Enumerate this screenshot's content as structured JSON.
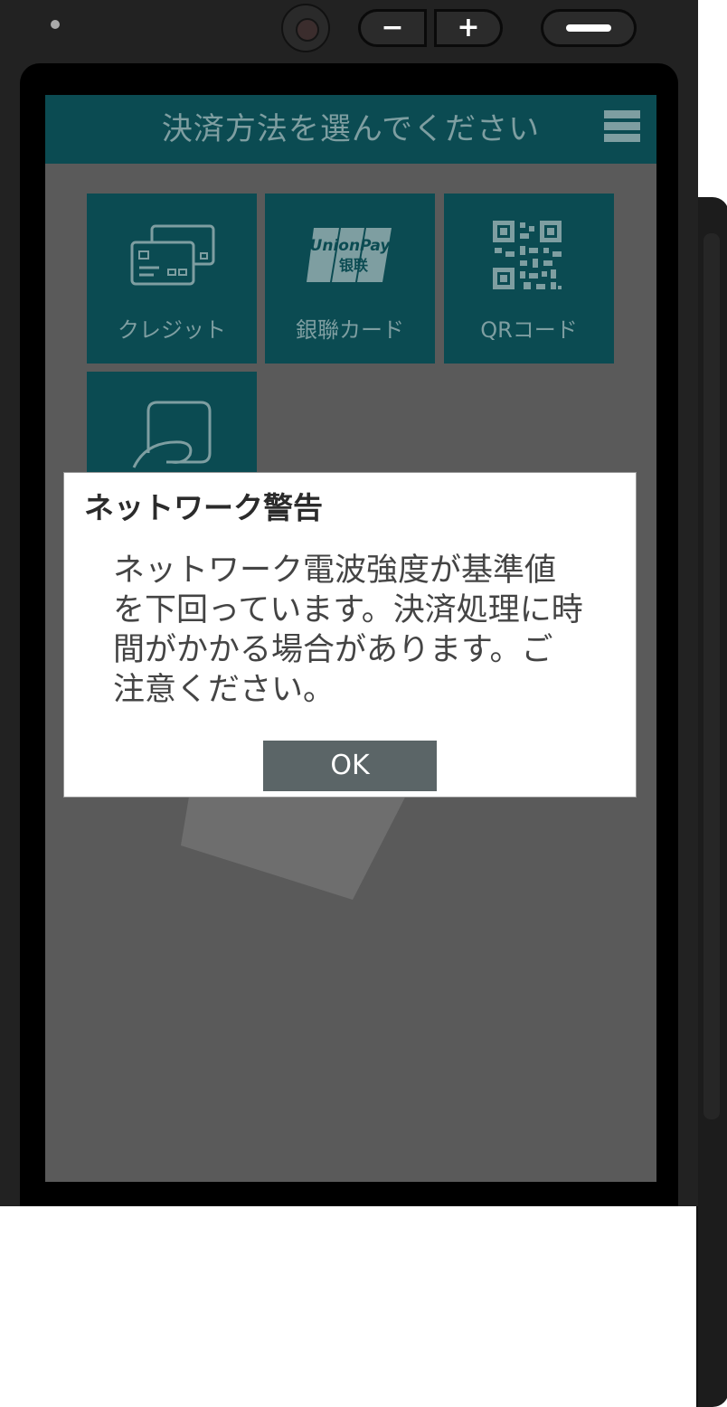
{
  "header": {
    "title": "決済方法を選んでください"
  },
  "tiles": [
    {
      "label": "クレジット",
      "icon": "credit-card-icon"
    },
    {
      "label": "銀聯カード",
      "icon": "unionpay-icon"
    },
    {
      "label": "QRコード",
      "icon": "qr-code-icon"
    },
    {
      "label": "",
      "icon": "contactless-icon"
    }
  ],
  "unionpay_logo": {
    "line1": "UnionPay",
    "line2": "银联"
  },
  "dialog": {
    "title": "ネットワーク警告",
    "message": "ネットワーク電波強度が基準値を下回っています。決済処理に時間がかかる場合があります。ご注意ください。",
    "ok_label": "OK"
  },
  "device": {
    "volume_down": "−",
    "volume_up": "+"
  },
  "colors": {
    "header_bg": "#0b4b52",
    "tile_bg": "#0b4b52",
    "screen_overlay": "#5a5a5a",
    "ok_button_bg": "#5b6567"
  }
}
